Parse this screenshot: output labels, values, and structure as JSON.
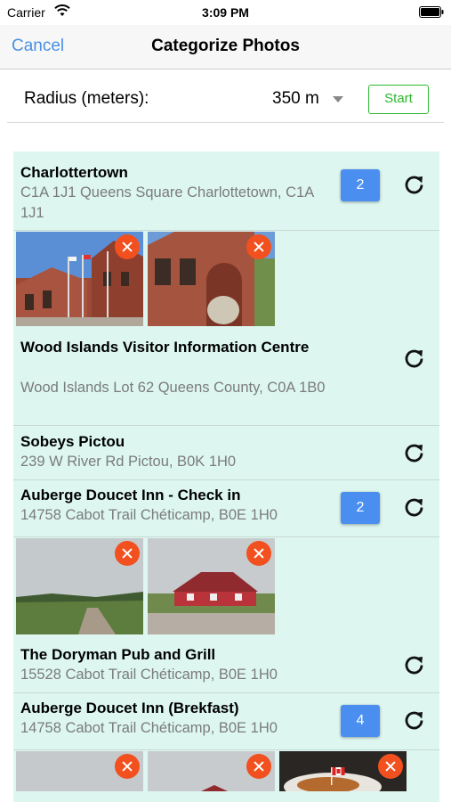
{
  "status_bar": {
    "carrier": "Carrier",
    "time": "3:09 PM"
  },
  "nav": {
    "cancel_label": "Cancel",
    "title": "Categorize Photos"
  },
  "radius": {
    "label": "Radius (meters):",
    "value": "350 m",
    "start_label": "Start"
  },
  "places": [
    {
      "name": "Charlottertown",
      "address": "C1A 1J1 Queens Square Charlottetown, C1A 1J1",
      "photo_count": "2"
    },
    {
      "name": "Wood Islands Visitor Information Centre",
      "address": "Wood Islands Lot 62 Queens County, C0A 1B0"
    },
    {
      "name": "Sobeys Pictou",
      "address": "239 W River Rd Pictou, B0K 1H0"
    },
    {
      "name": "Auberge Doucet Inn - Check in",
      "address": "14758 Cabot Trail Chéticamp, B0E 1H0",
      "photo_count": "2"
    },
    {
      "name": "The Doryman Pub and Grill",
      "address": "15528 Cabot Trail Chéticamp, B0E 1H0"
    },
    {
      "name": "Auberge Doucet Inn (Brekfast)",
      "address": "14758 Cabot Trail Chéticamp, B0E 1H0",
      "photo_count": "4"
    }
  ],
  "colors": {
    "accent": "#4a90e2",
    "start_green": "#2eb82e",
    "list_bg": "#ddf7f0",
    "badge_blue": "#4a8ff0",
    "remove_red": "#f2501e"
  }
}
